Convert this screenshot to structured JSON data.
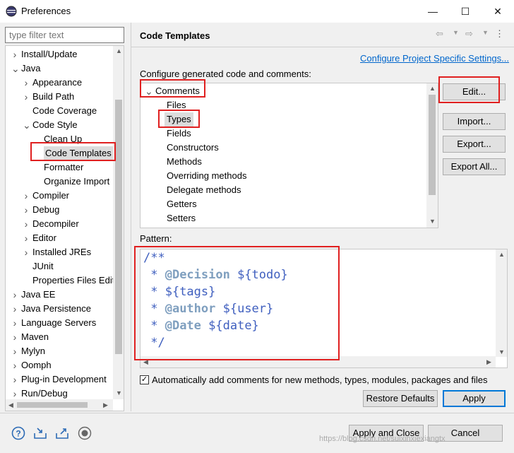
{
  "window": {
    "title": "Preferences",
    "minimize_glyph": "—",
    "maximize_glyph": "☐",
    "close_glyph": "✕"
  },
  "filter": {
    "placeholder": "type filter text"
  },
  "tree": {
    "items": [
      {
        "label": "Install/Update",
        "twisty": ">",
        "indent": 0
      },
      {
        "label": "Java",
        "twisty": "v",
        "indent": 0
      },
      {
        "label": "Appearance",
        "twisty": ">",
        "indent": 1
      },
      {
        "label": "Build Path",
        "twisty": ">",
        "indent": 1
      },
      {
        "label": "Code Coverage",
        "twisty": "",
        "indent": 1
      },
      {
        "label": "Code Style",
        "twisty": "v",
        "indent": 1
      },
      {
        "label": "Clean Up",
        "twisty": "",
        "indent": 2
      },
      {
        "label": "Code Templates",
        "twisty": "",
        "indent": 2,
        "selected": true
      },
      {
        "label": "Formatter",
        "twisty": "",
        "indent": 2
      },
      {
        "label": "Organize Import",
        "twisty": "",
        "indent": 2
      },
      {
        "label": "Compiler",
        "twisty": ">",
        "indent": 1
      },
      {
        "label": "Debug",
        "twisty": ">",
        "indent": 1
      },
      {
        "label": "Decompiler",
        "twisty": ">",
        "indent": 1
      },
      {
        "label": "Editor",
        "twisty": ">",
        "indent": 1
      },
      {
        "label": "Installed JREs",
        "twisty": ">",
        "indent": 1
      },
      {
        "label": "JUnit",
        "twisty": "",
        "indent": 1
      },
      {
        "label": "Properties Files Edit",
        "twisty": "",
        "indent": 1
      },
      {
        "label": "Java EE",
        "twisty": ">",
        "indent": 0
      },
      {
        "label": "Java Persistence",
        "twisty": ">",
        "indent": 0
      },
      {
        "label": "Language Servers",
        "twisty": ">",
        "indent": 0
      },
      {
        "label": "Maven",
        "twisty": ">",
        "indent": 0
      },
      {
        "label": "Mylyn",
        "twisty": ">",
        "indent": 0
      },
      {
        "label": "Oomph",
        "twisty": ">",
        "indent": 0
      },
      {
        "label": "Plug-in Development",
        "twisty": ">",
        "indent": 0
      },
      {
        "label": "Run/Debug",
        "twisty": ">",
        "indent": 0
      }
    ]
  },
  "page": {
    "title": "Code Templates",
    "config_link": "Configure Project Specific Settings...",
    "configure_label": "Configure generated code and comments:",
    "pattern_label": "Pattern:",
    "auto_comments_label": "Automatically add comments for new methods, types, modules, packages and files",
    "auto_comments_checked": true
  },
  "templates": {
    "items": [
      {
        "label": "Comments",
        "twisty": "v",
        "indent": 0
      },
      {
        "label": "Files",
        "indent": 1
      },
      {
        "label": "Types",
        "indent": 1,
        "selected": true
      },
      {
        "label": "Fields",
        "indent": 1
      },
      {
        "label": "Constructors",
        "indent": 1
      },
      {
        "label": "Methods",
        "indent": 1
      },
      {
        "label": "Overriding methods",
        "indent": 1
      },
      {
        "label": "Delegate methods",
        "indent": 1
      },
      {
        "label": "Getters",
        "indent": 1
      },
      {
        "label": "Setters",
        "indent": 1
      }
    ]
  },
  "pattern": {
    "lines": [
      {
        "prefix": "/**",
        "tag": "",
        "var": ""
      },
      {
        "prefix": " * ",
        "tag": "@Decision",
        "var": " ${todo}"
      },
      {
        "prefix": " * ",
        "tag": "",
        "var": "${tags}"
      },
      {
        "prefix": " * ",
        "tag": "@author",
        "var": " ${user}"
      },
      {
        "prefix": " * ",
        "tag": "@Date",
        "var": " ${date}"
      },
      {
        "prefix": " */",
        "tag": "",
        "var": ""
      }
    ]
  },
  "buttons": {
    "edit": "Edit...",
    "import": "Import...",
    "export": "Export...",
    "export_all": "Export All...",
    "restore_defaults": "Restore Defaults",
    "apply": "Apply",
    "apply_and_close": "Apply and Close",
    "cancel": "Cancel"
  },
  "bottom_icons": [
    "help-icon",
    "import-icon",
    "export-icon",
    "record-icon"
  ],
  "watermark": "https://blog.csdn.net/suixinxiexiangtx",
  "colors": {
    "accent": "#0078d7",
    "link": "#0066cc",
    "highlight": "#e02020",
    "javadoc": "#3f5fbf",
    "javadoc_tag": "#7f9fbf"
  }
}
